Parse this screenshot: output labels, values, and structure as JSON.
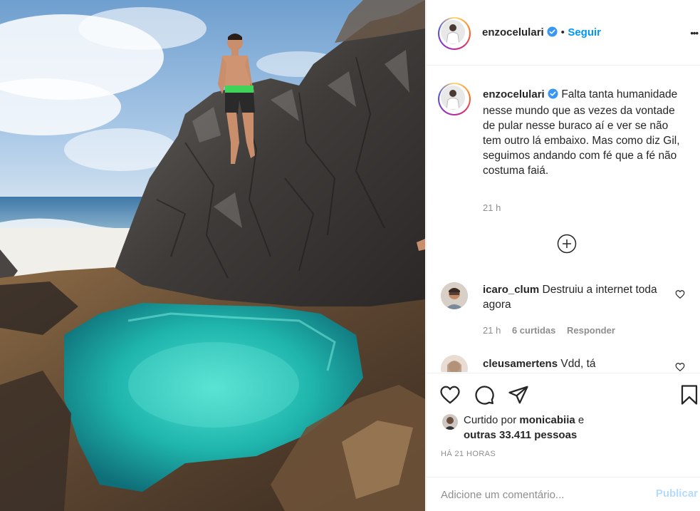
{
  "post": {
    "author": "enzocelulari",
    "follow_label": "Seguir",
    "dot": "•",
    "more_label": "•••",
    "caption": "Falta tanta humanidade nesse mundo que as vezes da vontade de pular nesse buraco aí e ver se não tem outro lá embaixo. Mas como diz Gil, seguimos andando com fé que a fé não costuma faiá.",
    "caption_time": "21 h"
  },
  "comments": [
    {
      "user": "icaro_clum",
      "text": "Destruiu a internet toda agora",
      "time": "21 h",
      "likes": "6 curtidas",
      "reply_label": "Responder"
    },
    {
      "user": "cleusamertens",
      "text": "Vdd, tá"
    }
  ],
  "likes": {
    "prefix": "Curtido por",
    "user": "monicabiia",
    "and": "e",
    "others": "outras 33.411 pessoas"
  },
  "posted_ago": "HÁ 21 HORAS",
  "comment_box": {
    "placeholder": "Adicione um comentário...",
    "publish_label": "Publicar"
  },
  "colors": {
    "accent": "#0095f6",
    "verified": "#3897f0",
    "publish_disabled": "#b3dbff",
    "muted": "#8e8e8e"
  },
  "icons": [
    "verified-badge-icon",
    "more-options-icon",
    "load-more-icon",
    "heart-icon",
    "comment-icon",
    "share-icon",
    "save-icon"
  ]
}
